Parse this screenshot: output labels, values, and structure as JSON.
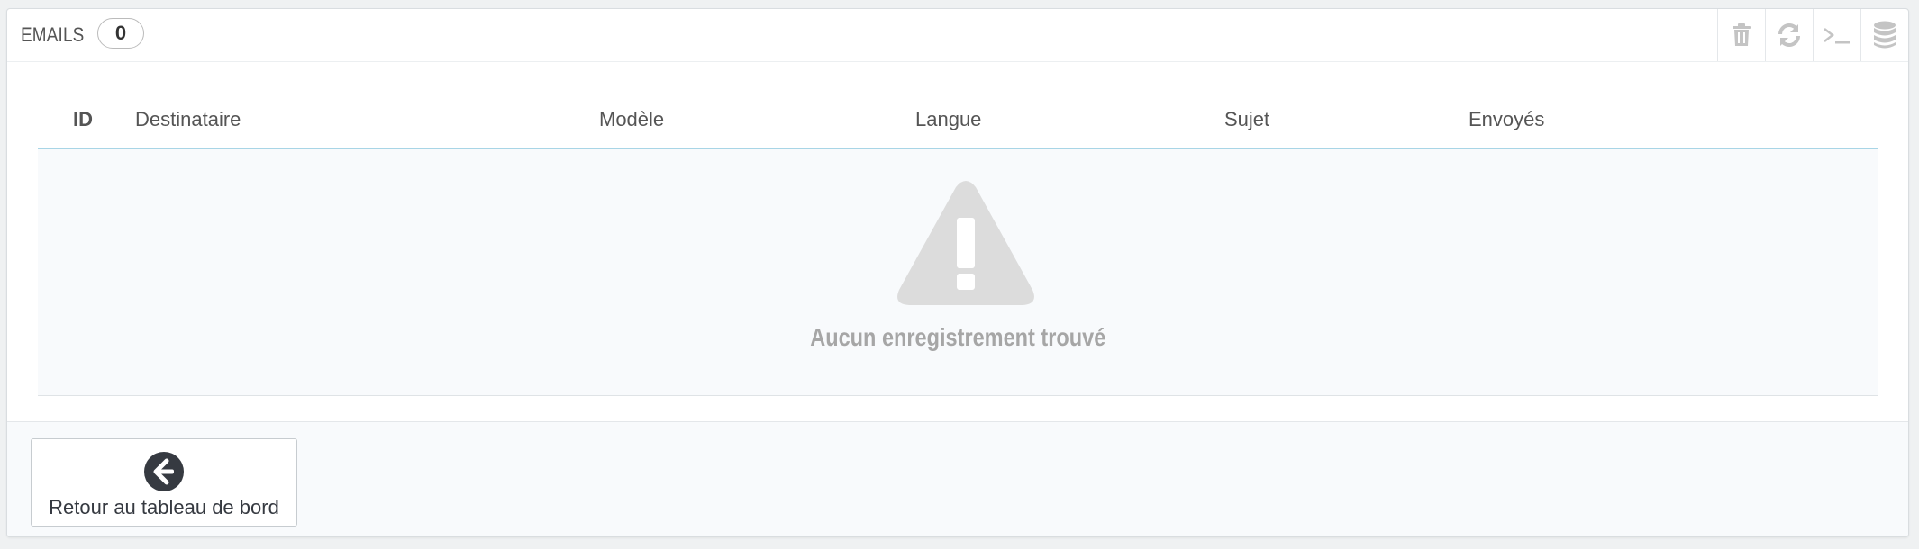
{
  "panel": {
    "title": "EMAILS",
    "count": "0"
  },
  "toolbar": {
    "items": [
      {
        "icon": "trash-icon",
        "name": "delete-all-button"
      },
      {
        "icon": "refresh-icon",
        "name": "refresh-button"
      },
      {
        "icon": "terminal-icon",
        "name": "sql-query-button"
      },
      {
        "icon": "database-icon",
        "name": "export-database-button"
      }
    ]
  },
  "table": {
    "columns": [
      "ID",
      "Destinataire",
      "Modèle",
      "Langue",
      "Sujet",
      "Envoyés"
    ],
    "rows": [],
    "empty_message": "Aucun enregistrement trouvé",
    "empty_icon": "warning-icon"
  },
  "footer": {
    "back_label": "Retour au tableau de bord",
    "back_icon": "arrow-circle-left-icon"
  },
  "colors": {
    "table_header_border": "#a8d5e6",
    "empty_text": "#a6a6a6",
    "icon_gray": "#bbbbbb"
  }
}
